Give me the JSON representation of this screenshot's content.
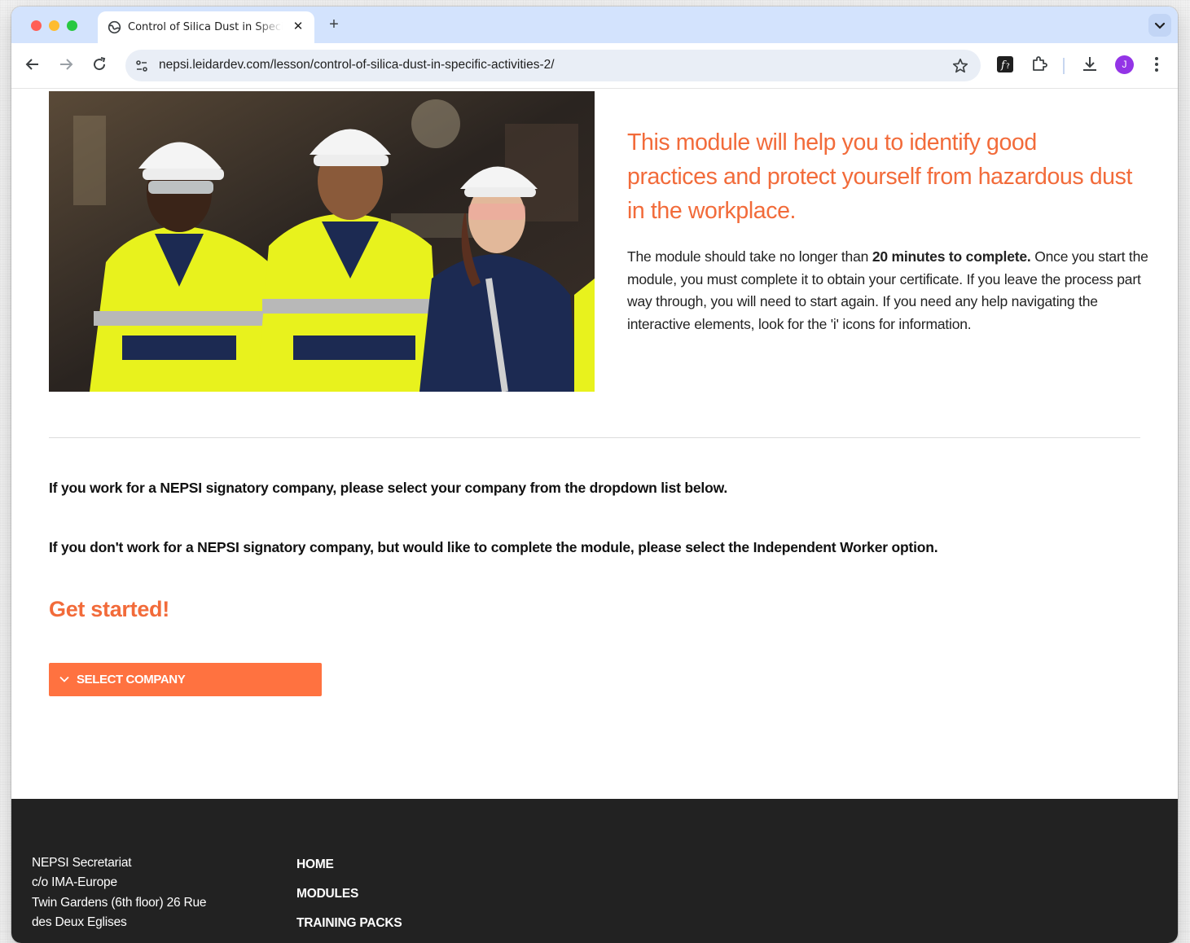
{
  "browser": {
    "tab_title": "Control of Silica Dust in Specific Activities",
    "url": "nepsi.leidardev.com/lesson/control-of-silica-dust-in-specific-activities-2/",
    "profile_initial": "J"
  },
  "hero": {
    "headline": "This module will help you to identify good practices and protect yourself from hazardous dust in the workplace.",
    "intro_pre": "The module should take no longer than ",
    "intro_bold": "20 minutes to complete.",
    "intro_post": " Once you start the module, you must complete it to obtain your certificate. If you leave the process part way through, you will need to start again. If you need any help navigating the interactive elements, look for the 'i' icons for information."
  },
  "instructions": {
    "signatory": "If you work for a NEPSI signatory company, please select your company from the dropdown list below.",
    "independent": "If you don't work for a NEPSI signatory company, but would like to complete the module, please select the Independent Worker option."
  },
  "get_started": "Get started!",
  "select_company": "SELECT COMPANY",
  "footer": {
    "address": [
      "NEPSI Secretariat",
      "c/o IMA-Europe",
      "Twin Gardens (6th floor) 26 Rue",
      "des Deux Eglises"
    ],
    "nav": [
      "HOME",
      "MODULES",
      "TRAINING PACKS"
    ]
  },
  "colors": {
    "accent": "#f26b3a",
    "button": "#ff7240",
    "footer_bg": "#222222"
  }
}
